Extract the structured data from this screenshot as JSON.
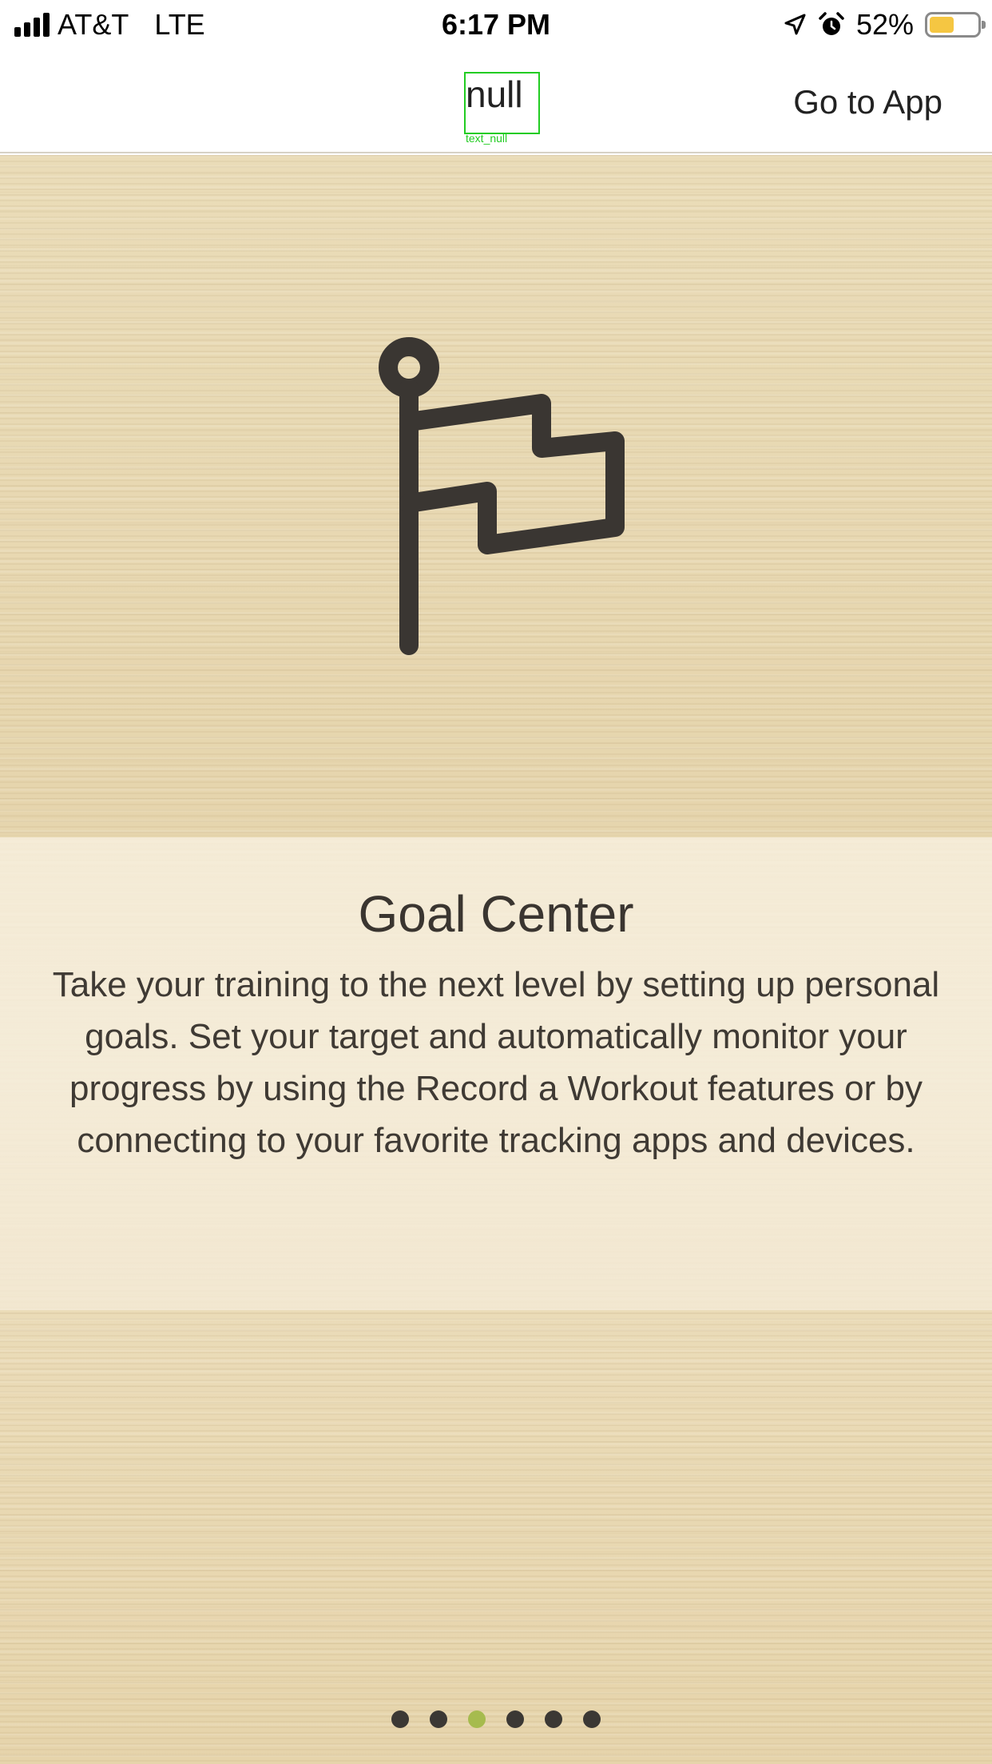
{
  "status_bar": {
    "carrier": "AT&T",
    "network": "LTE",
    "time": "6:17 PM",
    "battery_percent": "52%",
    "battery_level": 0.52,
    "icons": [
      "signal-icon",
      "location-arrow-icon",
      "alarm-icon",
      "battery-icon"
    ]
  },
  "nav": {
    "title": "null",
    "title_annotation": "text_null",
    "go_to_app_label": "Go to App"
  },
  "slide": {
    "icon": "flag-icon",
    "title": "Goal Center",
    "description": "Take your training to the next level by setting up personal goals. Set your target and automatically monitor your progress by using the Record a Workout features or by connecting to your favorite tracking apps and devices."
  },
  "pager": {
    "total": 6,
    "active_index": 2
  },
  "colors": {
    "icon": "#3a3632",
    "active_dot": "#a6bb4e",
    "inactive_dot": "#3b3834",
    "highlight_box": "#22cc22"
  }
}
